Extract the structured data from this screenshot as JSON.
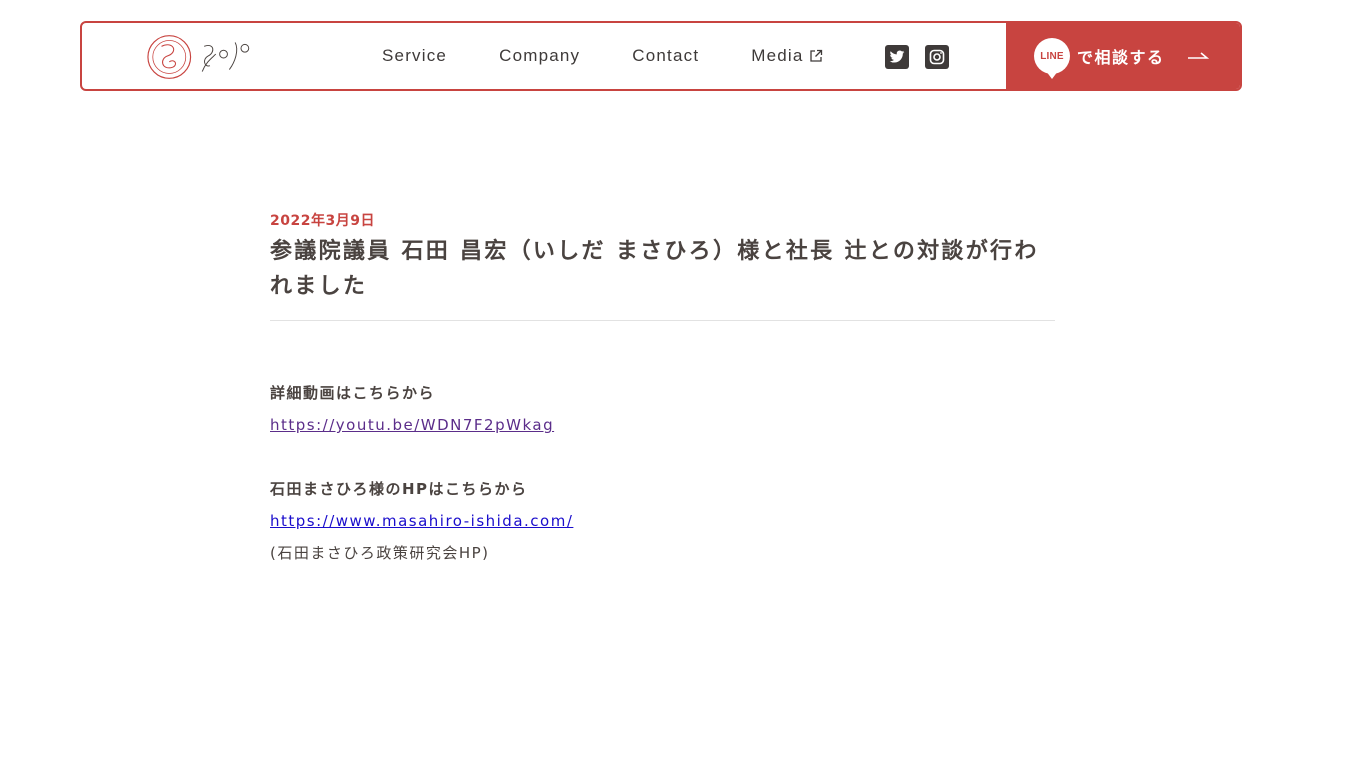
{
  "header": {
    "logo_alt": "yojo",
    "nav": [
      {
        "label": "Service"
      },
      {
        "label": "Company"
      },
      {
        "label": "Contact"
      },
      {
        "label": "Media"
      }
    ],
    "social": [
      "twitter-icon",
      "instagram-icon"
    ],
    "cta": {
      "badge": "LINE",
      "label": "で相談する"
    }
  },
  "article": {
    "date": "2022年3月9日",
    "title": "参議院議員 石田 昌宏（いしだ まさひろ）様と社長 辻との対談が行われました",
    "video_heading": "詳細動画はこちらから",
    "video_link": "https://youtu.be/WDN7F2pWkag",
    "hp_heading": "石田まさひろ様のHPはこちらから",
    "hp_link": "https://www.masahiro-ishida.com/",
    "hp_note": "(石田まさひろ政策研究会HP)"
  },
  "colors": {
    "accent": "#c84440",
    "text": "#4a4340",
    "visited_link": "#5b2d8a",
    "link": "#1a0dcc"
  }
}
